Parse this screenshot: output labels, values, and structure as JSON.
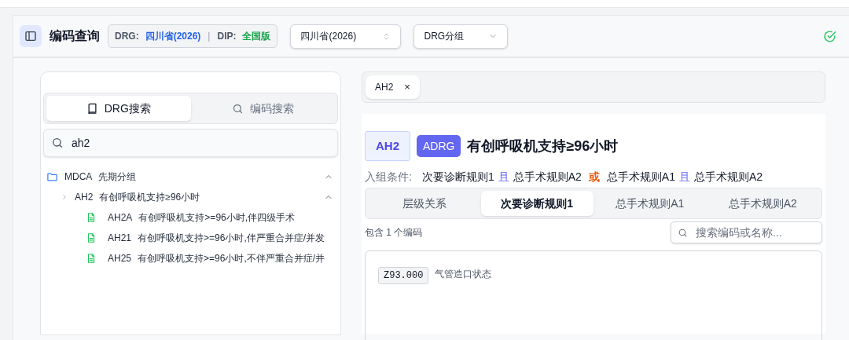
{
  "header": {
    "title": "编码查询",
    "versions": [
      {
        "label": "DRG:",
        "value": "四川省(2026)",
        "kind": "drg"
      },
      {
        "label": "DIP:",
        "value": "全国版",
        "kind": "dip"
      }
    ],
    "separator": "|",
    "selects": [
      {
        "value": "四川省(2026)",
        "kind": "updown"
      },
      {
        "value": "DRG分组",
        "kind": "down"
      }
    ]
  },
  "left_panel": {
    "tabs": [
      {
        "label": "DRG搜索",
        "selected": true,
        "kind": "book"
      },
      {
        "label": "编码搜索",
        "selected": false,
        "kind": "search"
      }
    ],
    "search": {
      "value": "ah2"
    },
    "tree": [
      {
        "code": "MDCA",
        "name": "先期分组",
        "expanded": true,
        "children": [
          {
            "code": "AH2",
            "name": "有创呼吸机支持≥96小时",
            "expanded": true,
            "children": [
              {
                "code": "AH2A",
                "name": "有创呼吸机支持>=96小时,伴四级手术"
              },
              {
                "code": "AH21",
                "name": "有创呼吸机支持>=96小时,伴严重合并症/并发"
              },
              {
                "code": "AH25",
                "name": "有创呼吸机支持>=96小时,不伴严重合并症/并"
              }
            ]
          }
        ]
      }
    ]
  },
  "open_tabs": [
    {
      "label": "AH2",
      "close": "×"
    }
  ],
  "detail": {
    "code": "AH2",
    "type": "ADRG",
    "title": "有创呼吸机支持≥96小时",
    "condition_label": "入组条件:",
    "condition": [
      {
        "text": "次要诊断规则1",
        "kind": "rule"
      },
      {
        "text": "且",
        "kind": "and"
      },
      {
        "text": "总手术规则A2",
        "kind": "rule"
      },
      {
        "text": "或",
        "kind": "or"
      },
      {
        "text": "总手术规则A1",
        "kind": "rule"
      },
      {
        "text": "且",
        "kind": "and"
      },
      {
        "text": "总手术规则A2",
        "kind": "rule"
      }
    ],
    "tabs": [
      {
        "label": "层级关系",
        "selected": false
      },
      {
        "label": "次要诊断规则1",
        "selected": true
      },
      {
        "label": "总手术规则A1",
        "selected": false
      },
      {
        "label": "总手术规则A2",
        "selected": false
      }
    ],
    "count": "包含 1 个编码",
    "filter_placeholder": "搜索编码或名称...",
    "codes": [
      {
        "code": "Z93.000",
        "name": "气管造口状态"
      }
    ]
  }
}
